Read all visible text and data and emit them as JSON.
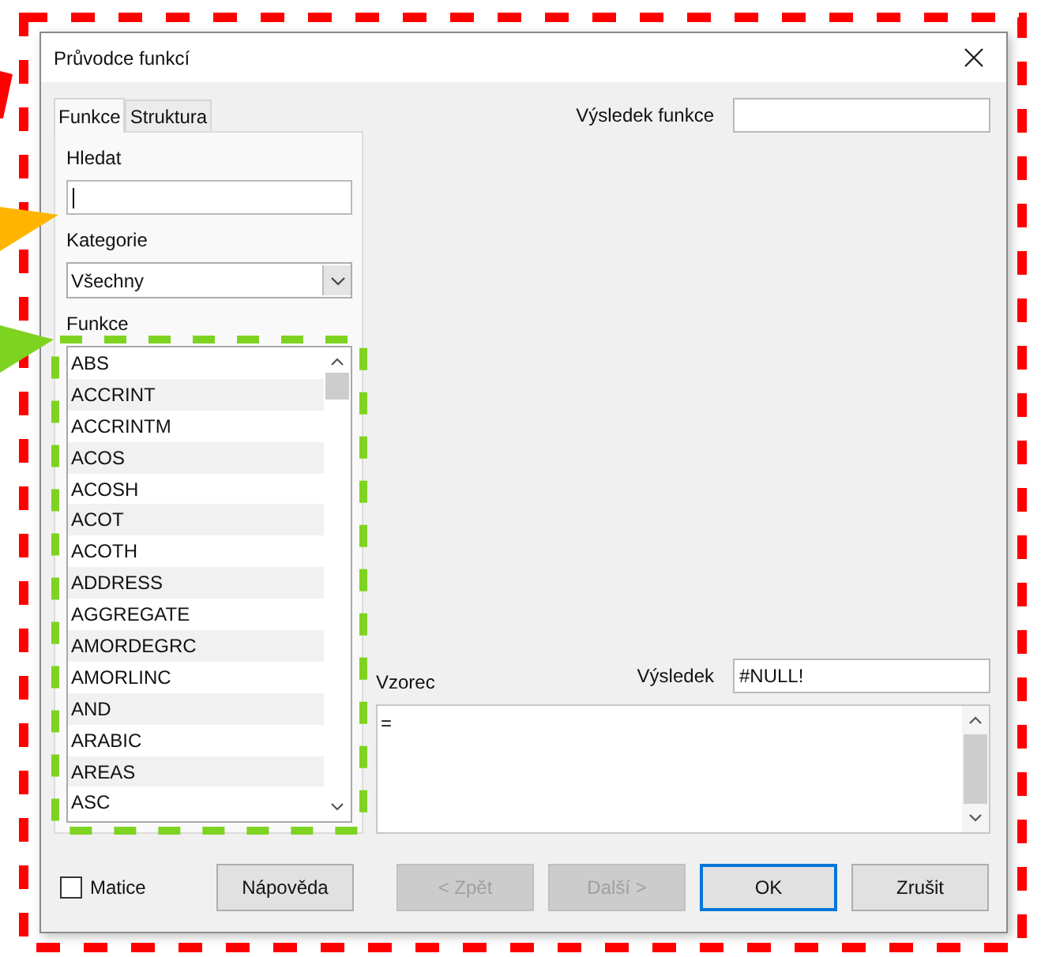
{
  "window": {
    "title": "Průvodce funkcí"
  },
  "tabs": [
    {
      "label": "Funkce",
      "selected": true
    },
    {
      "label": "Struktura",
      "selected": false
    }
  ],
  "search": {
    "label": "Hledat",
    "focused": true
  },
  "category": {
    "label": "Kategorie",
    "value": "Všechny"
  },
  "functions": {
    "label": "Funkce",
    "items": [
      "ABS",
      "ACCRINT",
      "ACCRINTM",
      "ACOS",
      "ACOSH",
      "ACOT",
      "ACOTH",
      "ADDRESS",
      "AGGREGATE",
      "AMORDEGRC",
      "AMORLINC",
      "AND",
      "ARABIC",
      "AREAS",
      "ASC"
    ]
  },
  "function_result": {
    "label": "Výsledek funkce"
  },
  "formula": {
    "label": "Vzorec",
    "value": "="
  },
  "result": {
    "label": "Výsledek",
    "value": "#NULL!"
  },
  "array_checkbox": {
    "label": "Matice",
    "checked": false
  },
  "buttons": [
    {
      "label": "Nápověda",
      "disabled": false,
      "default": false
    },
    {
      "label": "< Zpět",
      "disabled": true,
      "default": false
    },
    {
      "label": "Další >",
      "disabled": true,
      "default": false
    },
    {
      "label": "OK",
      "disabled": false,
      "default": true
    },
    {
      "label": "Zrušit",
      "disabled": false,
      "default": false
    }
  ]
}
